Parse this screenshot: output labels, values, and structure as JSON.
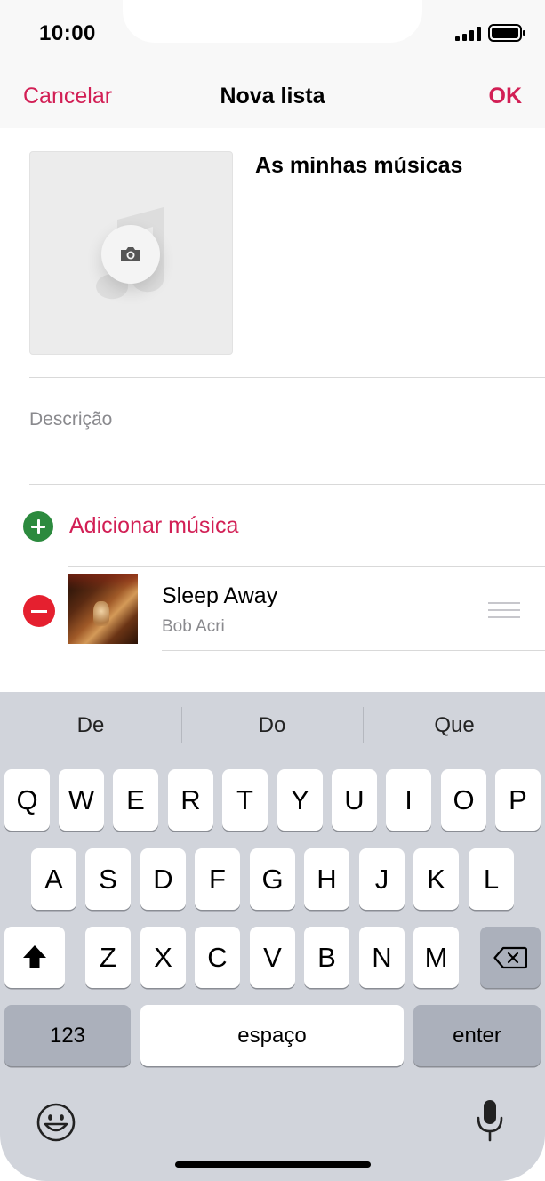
{
  "status_bar": {
    "time": "10:00",
    "icons": [
      "signal-icon",
      "battery-icon"
    ]
  },
  "nav": {
    "cancel": "Cancelar",
    "title": "Nova lista",
    "ok": "OK"
  },
  "playlist": {
    "title": "As minhas músicas",
    "description_placeholder": "Descrição",
    "artwork_icons": [
      "music-note-icon",
      "camera-icon"
    ]
  },
  "add_song": {
    "label": "Adicionar música",
    "icon": "plus-circle-icon"
  },
  "songs": [
    {
      "title": "Sleep Away",
      "artist": "Bob Acri",
      "icons": [
        "minus-circle-icon",
        "reorder-icon"
      ]
    }
  ],
  "keyboard": {
    "suggestions": [
      "De",
      "Do",
      "Que"
    ],
    "row1": [
      "Q",
      "W",
      "E",
      "R",
      "T",
      "Y",
      "U",
      "I",
      "O",
      "P"
    ],
    "row2": [
      "A",
      "S",
      "D",
      "F",
      "G",
      "H",
      "J",
      "K",
      "L"
    ],
    "row3": [
      "Z",
      "X",
      "C",
      "V",
      "B",
      "N",
      "M"
    ],
    "numbers_key": "123",
    "space_key": "espaço",
    "enter_key": "enter",
    "icons": [
      "shift-icon",
      "backspace-icon",
      "emoji-icon",
      "microphone-icon"
    ]
  },
  "colors": {
    "accent": "#d21f55",
    "add": "#2c8a3e",
    "remove": "#e5202f",
    "keyboard_bg": "#d1d4db"
  }
}
